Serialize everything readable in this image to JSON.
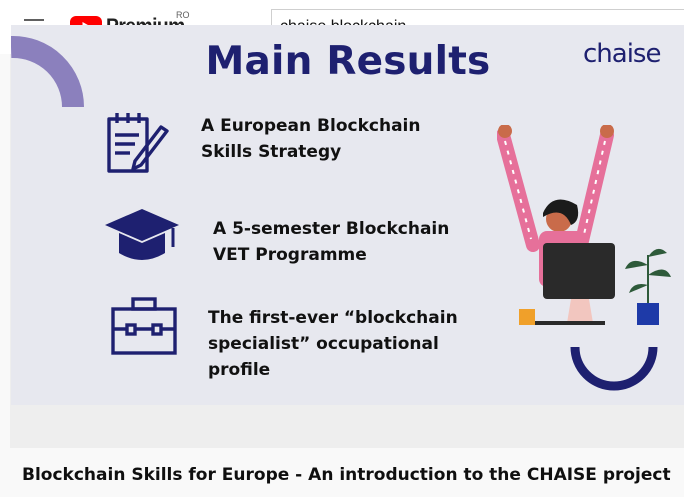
{
  "header": {
    "brand": "Premium",
    "region": "RO",
    "search_value": "chaise blockchain"
  },
  "video": {
    "slide": {
      "title": "Main Results",
      "logo_text": "chaise",
      "items": [
        {
          "line1": "A European Blockchain",
          "line2": "Skills Strategy"
        },
        {
          "line1": "A 5-semester Blockchain",
          "line2": "VET Programme"
        },
        {
          "line1": "The first-ever “blockchain",
          "line2": "specialist” occupational",
          "line3": "profile"
        }
      ]
    },
    "title": "Blockchain Skills for Europe - An introduction to the CHAISE project"
  },
  "colors": {
    "navy": "#1e2070",
    "purple_arc": "#8b80bd",
    "slide_bg": "#e7e8ef",
    "youtube_red": "#ff0000"
  }
}
